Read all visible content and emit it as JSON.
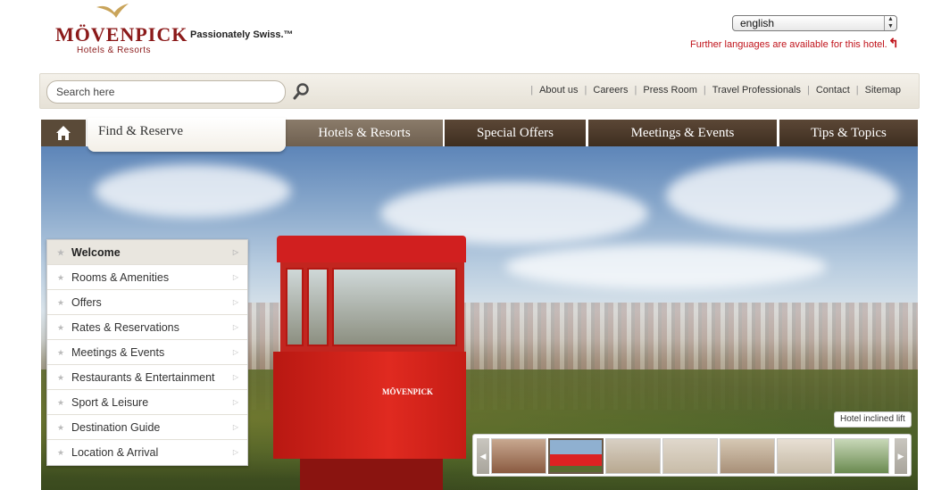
{
  "brand": {
    "name": "MÖVENPICK",
    "sub": "Hotels & Resorts",
    "tagline": "Passionately Swiss.™",
    "color": "#8b1a1a"
  },
  "language": {
    "selected": "english",
    "note": "Further languages are available for this hotel."
  },
  "search": {
    "placeholder": "Search here"
  },
  "toplinks": [
    "About us",
    "Careers",
    "Press Room",
    "Travel Professionals",
    "Contact",
    "Sitemap"
  ],
  "nav": {
    "home_icon": "home-icon",
    "find": "Find & Reserve",
    "tabs": [
      "Hotels & Resorts",
      "Special Offers",
      "Meetings & Events",
      "Tips & Topics"
    ]
  },
  "sidemenu": [
    "Welcome",
    "Rooms & Amenities",
    "Offers",
    "Rates & Reservations",
    "Meetings & Events",
    "Restaurants & Entertainment",
    "Sport & Leisure",
    "Destination Guide",
    "Location & Arrival"
  ],
  "hero": {
    "caption": "Hotel inclined lift",
    "cabin_logo": "MÖVENPICK"
  }
}
